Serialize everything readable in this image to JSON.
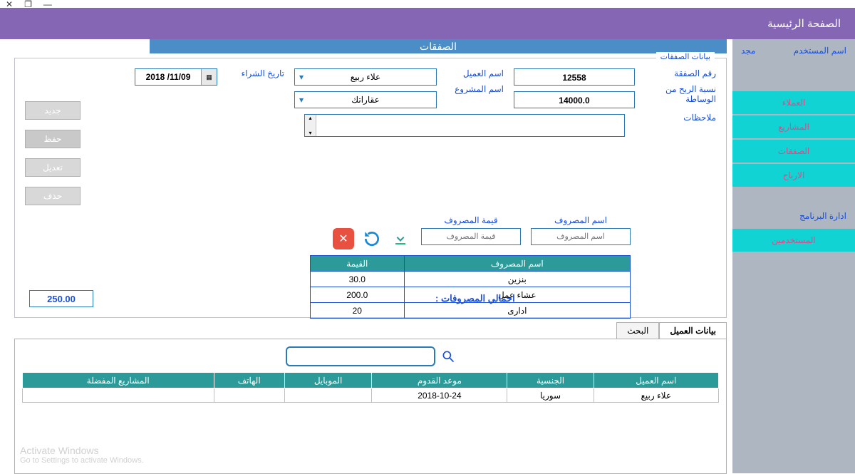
{
  "window": {
    "close": "✕",
    "max": "❐",
    "min": "—"
  },
  "header": {
    "title": "الصفحة الرئيسية"
  },
  "sidebar": {
    "user_label": "اسم المستخدم",
    "user_value": "مجد",
    "items": [
      "العملاء",
      "المشاريع",
      "الصفقات",
      "الارباح"
    ],
    "admin_label": "ادارة البرنامج",
    "admin_item": "المستخدمين"
  },
  "content": {
    "title": "الصفقات",
    "panel_title": "بيانات الصفقات",
    "labels": {
      "deal_no": "رقم الصفقة",
      "profit_pct": "نسبة الربح من الوساطة",
      "client_name": "اسم العميل",
      "project_name": "اسم المشروع",
      "purchase_date": "تاريخ الشراء",
      "notes": "ملاحظات",
      "expense_name": "اسم المصروف",
      "expense_value": "قيمة المصروف",
      "total_expenses": "اجمالي المصروفات :"
    },
    "values": {
      "deal_no": "12558",
      "profit_pct": "14000.0",
      "client_sel": "علاء ربيع",
      "project_sel": "عقاراتك",
      "purchase_date": "11/09/ 2018",
      "exp_name_placeholder": "اسم المصروف",
      "exp_val_placeholder": "قيمة المصروف",
      "total": "250.00"
    },
    "crud": {
      "new": "جديد",
      "save": "حفظ",
      "edit": "تعديل",
      "delete": "حذف"
    },
    "exp_headers": {
      "name": "اسم المصروف",
      "value": "القيمة"
    },
    "exp_rows": [
      {
        "name": "بنزين",
        "value": "30.0"
      },
      {
        "name": "عشاء عمل",
        "value": "200.0"
      },
      {
        "name": "ادارى",
        "value": "20"
      }
    ]
  },
  "tabs": {
    "data": "بيانات العميل",
    "search": "البحث"
  },
  "clients": {
    "headers": {
      "name": "اسم العميل",
      "nationality": "الجنسية",
      "arrival": "موعد القدوم",
      "mobile": "الموبايل",
      "phone": "الهاتف",
      "fav_projects": "المشاريع المفضلة"
    },
    "rows": [
      {
        "name": "علاء ربيع",
        "nationality": "سوريا",
        "arrival": "2018-10-24",
        "mobile": "",
        "phone": "",
        "fav": ""
      }
    ]
  },
  "watermark": {
    "l1": "Activate Windows",
    "l2": "Go to Settings to activate Windows."
  }
}
